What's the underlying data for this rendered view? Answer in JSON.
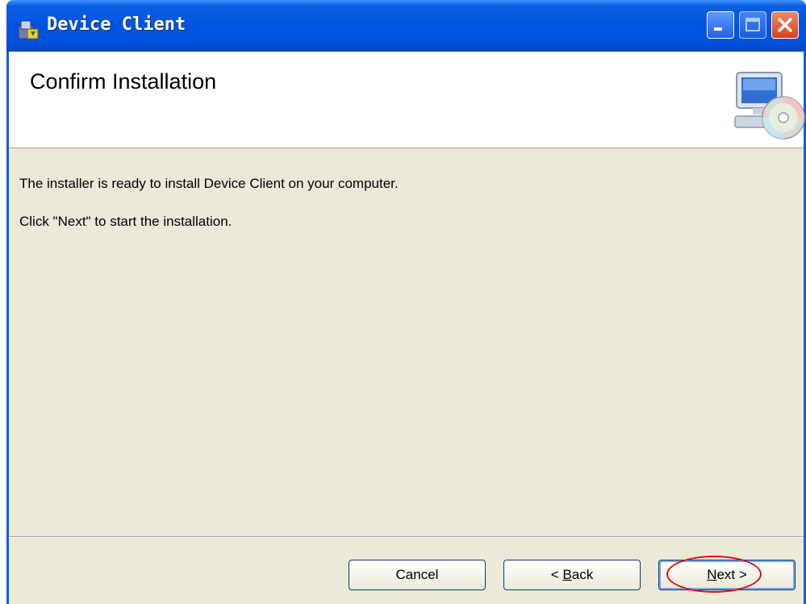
{
  "window": {
    "title": "Device Client"
  },
  "header": {
    "title": "Confirm Installation"
  },
  "body": {
    "line1": "The installer is ready to install Device Client on your computer.",
    "line2": "Click \"Next\" to start the installation."
  },
  "buttons": {
    "cancel": "Cancel",
    "back_prefix": "< ",
    "back_mnemonic": "B",
    "back_rest": "ack",
    "next_mnemonic": "N",
    "next_rest": "ext >"
  },
  "icons": {
    "app": "installer-icon",
    "header": "computer-cd-icon"
  },
  "colors": {
    "titlebar": "#0054e3",
    "close_button": "#d64018",
    "dialog_background": "#ece9d8",
    "highlight_annotation": "#e01010"
  }
}
